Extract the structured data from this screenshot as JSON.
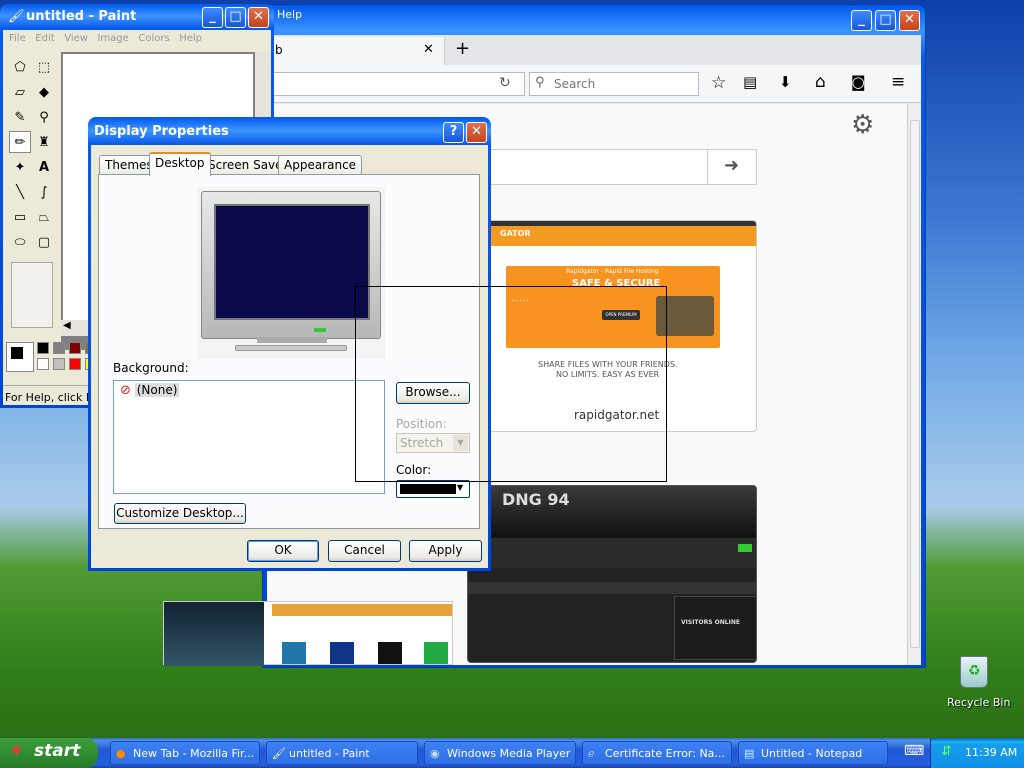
{
  "firefox": {
    "menu_help": "Help",
    "tab_title": "b",
    "search_placeholder": "Search",
    "tiles": [
      {
        "caption": "rapidgator.net",
        "promo_title": "Rapidgator - Rapid File Hosting",
        "promo_headline": "SAFE & SECURE",
        "promo_button": "OPEN PREMIUM",
        "tagline1": "SHARE FILES WITH YOUR FRIENDS.",
        "tagline2": "NO LIMITS. EASY AS EVER",
        "logo": "GATOR"
      },
      {
        "dark_label": "VISITORS ONLINE",
        "dark_tag": "DNG 94"
      }
    ]
  },
  "paint": {
    "title": "untitled - Paint",
    "menu": [
      "File",
      "Edit",
      "View",
      "Image",
      "Colors",
      "Help"
    ],
    "status": "For Help, click He",
    "palette": [
      "#000000",
      "#808080",
      "#800000",
      "#808000",
      "#ffffff",
      "#c0c0c0",
      "#ff0000",
      "#ffff00"
    ]
  },
  "display_properties": {
    "title": "Display Properties",
    "tabs": [
      "Themes",
      "Desktop",
      "Screen Saver",
      "Appearance"
    ],
    "background_label": "Background:",
    "background_items": [
      "(None)"
    ],
    "browse_button": "Browse...",
    "position_label": "Position:",
    "position_value": "Stretch",
    "color_label": "Color:",
    "color_value": "#000000",
    "preview_color": "#0a0a4a",
    "customize_button": "Customize Desktop...",
    "ok_button": "OK",
    "cancel_button": "Cancel",
    "apply_button": "Apply"
  },
  "desktop": {
    "recycle_bin": "Recycle Bin"
  },
  "taskbar": {
    "start": "start",
    "tasks": [
      "New Tab - Mozilla Fir...",
      "untitled - Paint",
      "Windows Media Player",
      "Certificate Error: Na...",
      "Untitled - Notepad"
    ],
    "clock": "11:39 AM"
  }
}
